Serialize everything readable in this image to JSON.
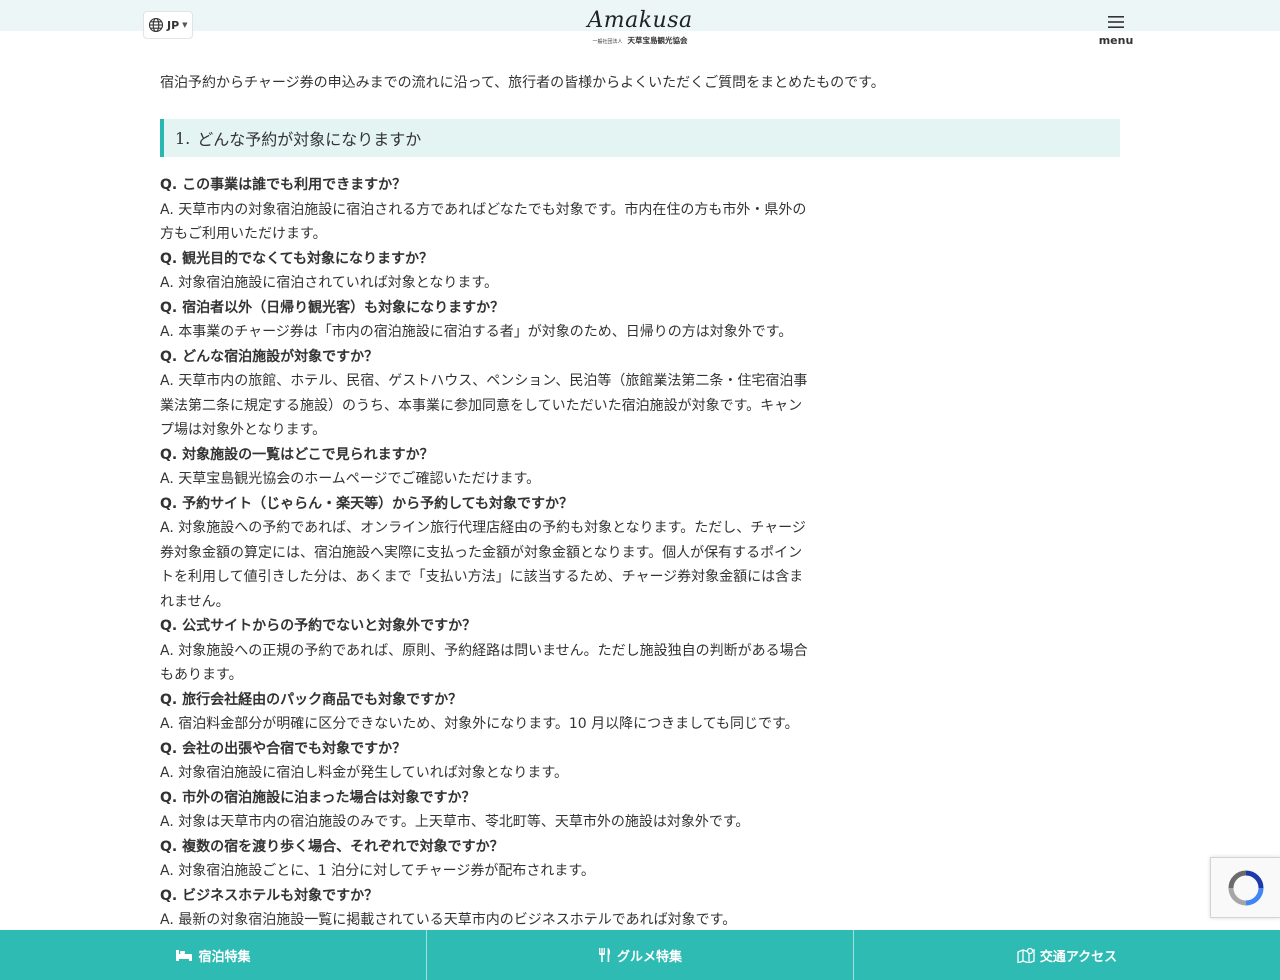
{
  "header": {
    "lang_code": "JP",
    "logo_text": "Amakusa",
    "logo_small": "一般社団法人",
    "logo_org": "天草宝島観光協会",
    "menu_label": "menu"
  },
  "intro": "宿泊予約からチャージ券の申込みまでの流れに沿って、旅行者の皆様からよくいただくご質問をまとめたものです。",
  "section": {
    "number": "1.",
    "title": "どんな予約が対象になりますか"
  },
  "faq": [
    {
      "q": "Q. この事業は誰でも利用できますか？",
      "a": "A. 天草市内の対象宿泊施設に宿泊される方であればどなたでも対象です。市内在住の方も市外・県外の方もご利用いただけます。"
    },
    {
      "q": "Q. 観光目的でなくても対象になりますか？",
      "a": "A. 対象宿泊施設に宿泊されていれば対象となります。"
    },
    {
      "q": "Q. 宿泊者以外（日帰り観光客）も対象になりますか？",
      "a": "A. 本事業のチャージ券は「市内の宿泊施設に宿泊する者」が対象のため、日帰りの方は対象外です。"
    },
    {
      "q": "Q. どんな宿泊施設が対象ですか？",
      "a": "A. 天草市内の旅館、ホテル、民宿、ゲストハウス、ペンション、民泊等（旅館業法第二条・住宅宿泊事業法第二条に規定する施設）のうち、本事業に参加同意をしていただいた宿泊施設が対象です。キャンプ場は対象外となります。"
    },
    {
      "q": "Q. 対象施設の一覧はどこで見られますか？",
      "a": "A. 天草宝島観光協会のホームページでご確認いただけます。"
    },
    {
      "q": "Q. 予約サイト（じゃらん・楽天等）から予約しても対象ですか？",
      "a": "A. 対象施設への予約であれば、オンライン旅行代理店経由の予約も対象となります。ただし、チャージ券対象金額の算定には、宿泊施設へ実際に支払った金額が対象金額となります。個人が保有するポイントを利用して値引きした分は、あくまで「支払い方法」に該当するため、チャージ券対象金額には含まれません。"
    },
    {
      "q": "Q. 公式サイトからの予約でないと対象外ですか？",
      "a": "A. 対象施設への正規の予約であれば、原則、予約経路は問いません。ただし施設独自の判断がある場合もあります。"
    },
    {
      "q": "Q. 旅行会社経由のパック商品でも対象ですか？",
      "a": "A. 宿泊料金部分が明確に区分できないため、対象外になります。10 月以降につきましても同じです。"
    },
    {
      "q": "Q. 会社の出張や合宿でも対象ですか？",
      "a": "A. 対象宿泊施設に宿泊し料金が発生していれば対象となります。"
    },
    {
      "q": "Q. 市外の宿泊施設に泊まった場合は対象ですか？",
      "a": "A. 対象は天草市内の宿泊施設のみです。上天草市、苓北町等、天草市外の施設は対象外です。"
    },
    {
      "q": "Q. 複数の宿を渡り歩く場合、それぞれで対象ですか？",
      "a": "A. 対象宿泊施設ごとに、1 泊分に対してチャージ券が配布されます。"
    },
    {
      "q": "Q. ビジネスホテルも対象ですか？",
      "a": "A. 最新の対象宿泊施設一覧に掲載されている天草市内のビジネスホテルであれば対象です。"
    }
  ],
  "footer": {
    "items": [
      {
        "label": "宿泊特集",
        "icon": "bed-icon"
      },
      {
        "label": "グルメ特集",
        "icon": "fork-knife-icon"
      },
      {
        "label": "交通アクセス",
        "icon": "map-icon"
      }
    ]
  },
  "colors": {
    "accent": "#2dbbb3",
    "header_bg": "#edf6f6",
    "heading_bg": "#e3f4f3",
    "heading_border": "#2ab7b1",
    "text": "#333333"
  }
}
